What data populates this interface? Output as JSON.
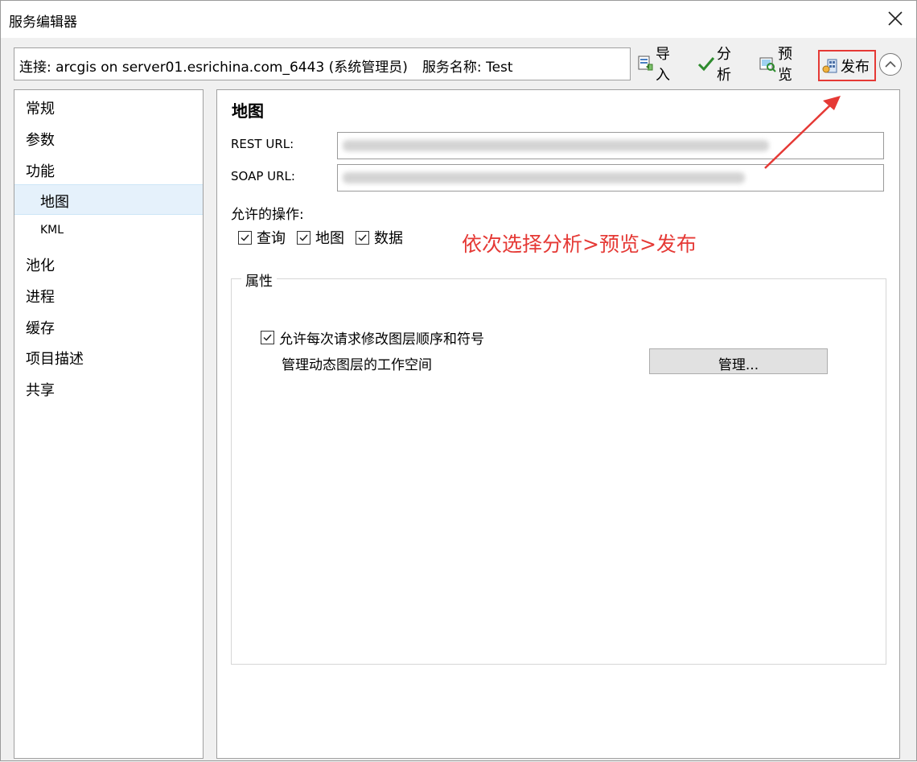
{
  "window": {
    "title": "服务编辑器"
  },
  "connection": {
    "text": "连接: arcgis on server01.esrichina.com_6443 (系统管理员)",
    "service_name": "服务名称: Test"
  },
  "toolbar": {
    "import_label": "导入",
    "analyze_label": "分析",
    "preview_label": "预览",
    "publish_label": "发布",
    "import_icon": "import-icon",
    "analyze_icon": "checkmark-icon",
    "preview_icon": "preview-icon",
    "publish_icon": "publish-icon",
    "highlight_color": "#e53935"
  },
  "sidebar": {
    "items": [
      {
        "label": "常规"
      },
      {
        "label": "参数"
      },
      {
        "label": "功能"
      },
      {
        "label": "地图"
      },
      {
        "label": "KML"
      },
      {
        "label": "池化"
      },
      {
        "label": "进程"
      },
      {
        "label": "缓存"
      },
      {
        "label": "项目描述"
      },
      {
        "label": "共享"
      }
    ],
    "selected": "地图",
    "selected_color": "#e5f1fb"
  },
  "main": {
    "title": "地图",
    "rest_url_label": "REST URL:",
    "soap_url_label": "SOAP URL:",
    "allowed_ops_label": "允许的操作:",
    "operations": [
      {
        "label": "查询",
        "checked": true
      },
      {
        "label": "地图",
        "checked": true
      },
      {
        "label": "数据",
        "checked": true
      }
    ],
    "annotation": "依次选择分析>预览>发布",
    "annotation_color": "#e53935",
    "properties": {
      "legend": "属性",
      "allow_modify_label": "允许每次请求修改图层顺序和符号",
      "allow_modify_checked": true,
      "workspace_label": "管理动态图层的工作空间",
      "manage_button": "管理..."
    }
  }
}
